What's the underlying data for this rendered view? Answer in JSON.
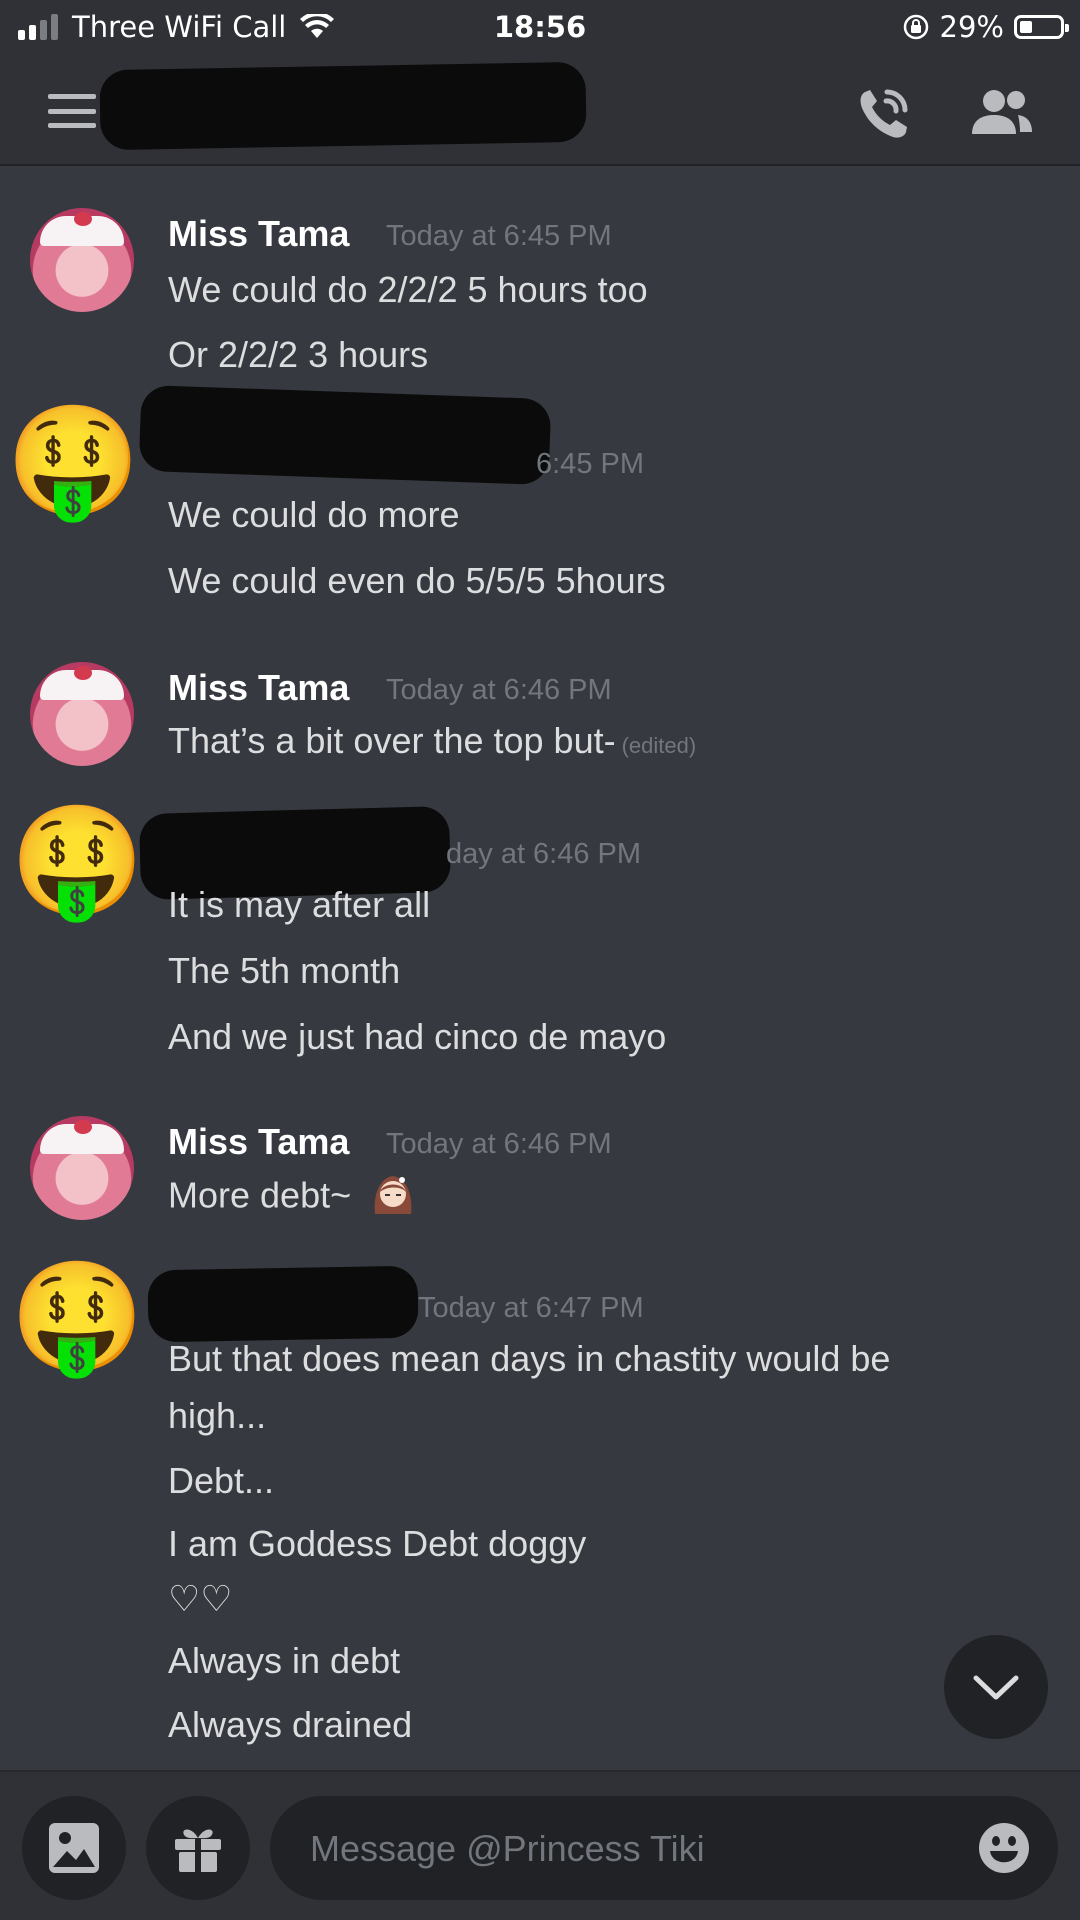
{
  "status_bar": {
    "carrier": "Three WiFi Call",
    "time": "18:56",
    "battery": "29%"
  },
  "header": {
    "menu_icon": "hamburger-icon",
    "call_icon": "phone-call-icon",
    "members_icon": "members-icon"
  },
  "messages": [
    {
      "author": "Miss Tama",
      "timestamp": "Today at 6:45 PM",
      "lines": [
        "We could do 2/2/2 5 hours too",
        "Or 2/2/2 3 hours"
      ]
    },
    {
      "timestamp": "6:45 PM",
      "lines": [
        "We could do more",
        "We could even do 5/5/5 5hours"
      ]
    },
    {
      "author": "Miss Tama",
      "timestamp": "Today at 6:46 PM",
      "lines": [
        "That’s a bit over the top but-"
      ],
      "edited": "(edited)"
    },
    {
      "timestamp": "day at 6:46 PM",
      "lines": [
        "It is may after all",
        "The 5th month",
        "And we just had cinco de mayo"
      ]
    },
    {
      "author": "Miss Tama",
      "timestamp": "Today at 6:46 PM",
      "lines": [
        "More debt~"
      ]
    },
    {
      "timestamp": "Today at 6:47 PM",
      "lines": [
        "But that does mean days in chastity would be",
        "high...",
        "Debt...",
        "I am Goddess Debt doggy",
        "♡♡",
        "Always in debt",
        "Always drained"
      ]
    }
  ],
  "composer": {
    "placeholder": "Message @Princess Tiki"
  },
  "colors": {
    "background": "#36393f",
    "header": "#2f3136",
    "dark": "#202225",
    "text": "#dcddde",
    "muted": "#72767d"
  }
}
